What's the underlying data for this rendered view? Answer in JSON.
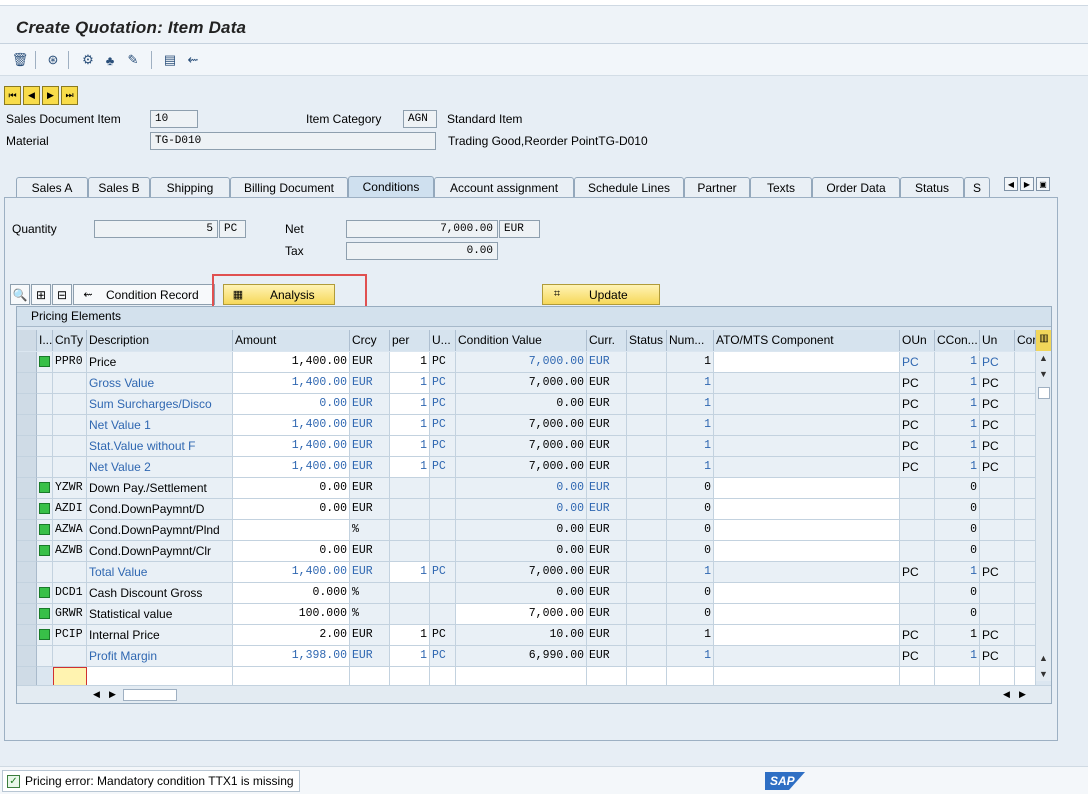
{
  "window": {
    "title": "Create Quotation: Item Data"
  },
  "toolbar": {
    "icons": [
      "trash-icon",
      "overview-icon",
      "header-icon",
      "item-icon",
      "edit-icon",
      "display-icon",
      "document-flow-icon"
    ]
  },
  "header": {
    "sales_doc_item_label": "Sales Document Item",
    "sales_doc_item_value": "10",
    "item_category_label": "Item Category",
    "item_category_value": "AGN",
    "item_category_text": "Standard Item",
    "material_label": "Material",
    "material_value": "TG-D010",
    "material_text": "Trading Good,Reorder PointTG-D010"
  },
  "tabs": [
    "Sales A",
    "Sales B",
    "Shipping",
    "Billing Document",
    "Conditions",
    "Account assignment",
    "Schedule Lines",
    "Partner",
    "Texts",
    "Order Data",
    "Status",
    "S"
  ],
  "active_tab": "Conditions",
  "conditions": {
    "quantity_label": "Quantity",
    "quantity_value": "5",
    "quantity_unit": "PC",
    "net_label": "Net",
    "net_value": "7,000.00",
    "net_currency": "EUR",
    "tax_label": "Tax",
    "tax_value": "0.00",
    "btn_condition_record": "Condition Record",
    "btn_analysis": "Analysis",
    "btn_update": "Update"
  },
  "grid": {
    "title": "Pricing Elements",
    "headers": [
      "I...",
      "CnTy",
      "Description",
      "Amount",
      "Crcy",
      "per",
      "U...",
      "Condition Value",
      "Curr.",
      "Status",
      "Num...",
      "ATO/MTS Component",
      "OUn",
      "CCon...",
      "Un",
      "Cor"
    ],
    "rows": [
      {
        "status": true,
        "cnty": "PPR0",
        "desc": "Price",
        "amount": "1,400.00",
        "crcy": "EUR",
        "per": "1",
        "uom": "PC",
        "cval": "7,000.00",
        "curr": "EUR",
        "num": "1",
        "oun": "PC",
        "ccon": "1",
        "un": "PC",
        "blue": false,
        "cval_blue": true
      },
      {
        "status": false,
        "cnty": "",
        "desc": "Gross Value",
        "amount": "1,400.00",
        "crcy": "EUR",
        "per": "1",
        "uom": "PC",
        "cval": "7,000.00",
        "curr": "EUR",
        "num": "1",
        "oun": "PC",
        "ccon": "1",
        "un": "PC",
        "blue": true,
        "cval_blue": false
      },
      {
        "status": false,
        "cnty": "",
        "desc": "Sum Surcharges/Disco",
        "amount": "0.00",
        "crcy": "EUR",
        "per": "1",
        "uom": "PC",
        "cval": "0.00",
        "curr": "EUR",
        "num": "1",
        "oun": "PC",
        "ccon": "1",
        "un": "PC",
        "blue": true,
        "cval_blue": false
      },
      {
        "status": false,
        "cnty": "",
        "desc": "Net Value 1",
        "amount": "1,400.00",
        "crcy": "EUR",
        "per": "1",
        "uom": "PC",
        "cval": "7,000.00",
        "curr": "EUR",
        "num": "1",
        "oun": "PC",
        "ccon": "1",
        "un": "PC",
        "blue": true,
        "cval_blue": false
      },
      {
        "status": false,
        "cnty": "",
        "desc": "Stat.Value without F",
        "amount": "1,400.00",
        "crcy": "EUR",
        "per": "1",
        "uom": "PC",
        "cval": "7,000.00",
        "curr": "EUR",
        "num": "1",
        "oun": "PC",
        "ccon": "1",
        "un": "PC",
        "blue": true,
        "cval_blue": false
      },
      {
        "status": false,
        "cnty": "",
        "desc": "Net Value 2",
        "amount": "1,400.00",
        "crcy": "EUR",
        "per": "1",
        "uom": "PC",
        "cval": "7,000.00",
        "curr": "EUR",
        "num": "1",
        "oun": "PC",
        "ccon": "1",
        "un": "PC",
        "blue": true,
        "cval_blue": false
      },
      {
        "status": true,
        "cnty": "YZWR",
        "desc": "Down Pay./Settlement",
        "amount": "0.00",
        "crcy": "EUR",
        "per": "",
        "uom": "",
        "cval": "0.00",
        "curr": "EUR",
        "num": "0",
        "oun": "",
        "ccon": "0",
        "un": "",
        "blue": false,
        "cval_blue": true
      },
      {
        "status": true,
        "cnty": "AZDI",
        "desc": "Cond.DownPaymnt/D",
        "amount": "0.00",
        "crcy": "EUR",
        "per": "",
        "uom": "",
        "cval": "0.00",
        "curr": "EUR",
        "num": "0",
        "oun": "",
        "ccon": "0",
        "un": "",
        "blue": false,
        "cval_blue": true
      },
      {
        "status": true,
        "cnty": "AZWA",
        "desc": "Cond.DownPaymnt/Plnd",
        "amount": "",
        "crcy": "%",
        "per": "",
        "uom": "",
        "cval": "0.00",
        "curr": "EUR",
        "num": "0",
        "oun": "",
        "ccon": "0",
        "un": "",
        "blue": false,
        "cval_blue": false
      },
      {
        "status": true,
        "cnty": "AZWB",
        "desc": "Cond.DownPaymnt/Clr",
        "amount": "0.00",
        "crcy": "EUR",
        "per": "",
        "uom": "",
        "cval": "0.00",
        "curr": "EUR",
        "num": "0",
        "oun": "",
        "ccon": "0",
        "un": "",
        "blue": false,
        "cval_blue": false
      },
      {
        "status": false,
        "cnty": "",
        "desc": "Total Value",
        "amount": "1,400.00",
        "crcy": "EUR",
        "per": "1",
        "uom": "PC",
        "cval": "7,000.00",
        "curr": "EUR",
        "num": "1",
        "oun": "PC",
        "ccon": "1",
        "un": "PC",
        "blue": true,
        "cval_blue": false
      },
      {
        "status": true,
        "cnty": "DCD1",
        "desc": "Cash Discount Gross",
        "amount": "0.000",
        "crcy": "%",
        "per": "",
        "uom": "",
        "cval": "0.00",
        "curr": "EUR",
        "num": "0",
        "oun": "",
        "ccon": "0",
        "un": "",
        "blue": false,
        "cval_blue": false
      },
      {
        "status": true,
        "cnty": "GRWR",
        "desc": "Statistical value",
        "amount": "100.000",
        "crcy": "%",
        "per": "",
        "uom": "",
        "cval": "7,000.00",
        "curr": "EUR",
        "num": "0",
        "oun": "",
        "ccon": "0",
        "un": "",
        "blue": false,
        "cval_blue": false
      },
      {
        "status": true,
        "cnty": "PCIP",
        "desc": "Internal Price",
        "amount": "2.00",
        "crcy": "EUR",
        "per": "1",
        "uom": "PC",
        "cval": "10.00",
        "curr": "EUR",
        "num": "1",
        "oun": "PC",
        "ccon": "1",
        "un": "PC",
        "blue": false,
        "cval_blue": false
      },
      {
        "status": false,
        "cnty": "",
        "desc": "Profit Margin",
        "amount": "1,398.00",
        "crcy": "EUR",
        "per": "1",
        "uom": "PC",
        "cval": "6,990.00",
        "curr": "EUR",
        "num": "1",
        "oun": "PC",
        "ccon": "1",
        "un": "PC",
        "blue": true,
        "cval_blue": false
      }
    ]
  },
  "status": {
    "message": "Pricing error: Mandatory condition TTX1 is missing",
    "logo": "SAP"
  }
}
